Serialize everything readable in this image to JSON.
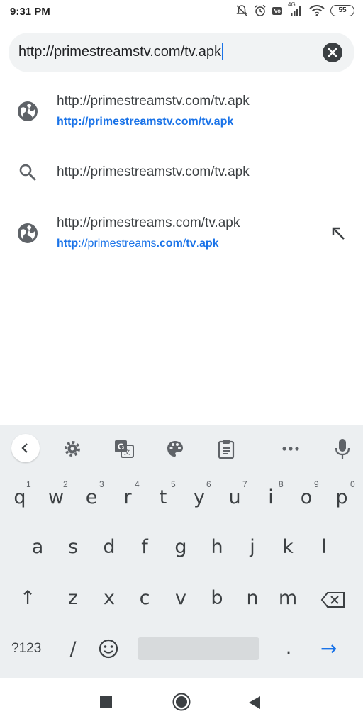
{
  "status_bar": {
    "time": "9:31 PM",
    "battery": "55",
    "network_label": "4G",
    "volte_label": "Vo"
  },
  "omnibox": {
    "value": "http://primestreamstv.com/tv.apk"
  },
  "suggestions": [
    {
      "icon": "globe-icon",
      "title": "http://primestreamstv.com/tv.apk",
      "url_parts": [
        {
          "text": "http://primestreamstv.com/tv.apk",
          "bold": true
        }
      ]
    },
    {
      "icon": "search-icon",
      "title": "http://primestreamstv.com/tv.apk"
    },
    {
      "icon": "globe-icon",
      "title": "http://primestreams.com/tv.apk",
      "url_parts": [
        {
          "text": "http",
          "bold": true
        },
        {
          "text": "://primestreams",
          "bold": false
        },
        {
          "text": ".com",
          "bold": true
        },
        {
          "text": "/",
          "bold": false
        },
        {
          "text": "tv",
          "bold": true
        },
        {
          "text": ".",
          "bold": false
        },
        {
          "text": "apk",
          "bold": true
        }
      ],
      "action_icon": "arrow-up-left-icon"
    }
  ],
  "keyboard": {
    "toolbar": [
      "back-chevron-icon",
      "settings-icon",
      "translate-icon",
      "palette-icon",
      "clipboard-icon",
      "more-icon",
      "microphone-icon"
    ],
    "row1": [
      {
        "key": "q",
        "hint": "1"
      },
      {
        "key": "w",
        "hint": "2"
      },
      {
        "key": "e",
        "hint": "3"
      },
      {
        "key": "r",
        "hint": "4"
      },
      {
        "key": "t",
        "hint": "5"
      },
      {
        "key": "y",
        "hint": "6"
      },
      {
        "key": "u",
        "hint": "7"
      },
      {
        "key": "i",
        "hint": "8"
      },
      {
        "key": "o",
        "hint": "9"
      },
      {
        "key": "p",
        "hint": "0"
      }
    ],
    "row2": [
      "a",
      "s",
      "d",
      "f",
      "g",
      "h",
      "j",
      "k",
      "l"
    ],
    "row3": [
      "z",
      "x",
      "c",
      "v",
      "b",
      "n",
      "m"
    ],
    "shift": "↑",
    "symbols_key": "?123",
    "slash_key": "/",
    "period_key": ".",
    "enter_key": "→"
  },
  "colors": {
    "accent": "#1a73e8",
    "keyboard_bg": "#eceff1"
  }
}
